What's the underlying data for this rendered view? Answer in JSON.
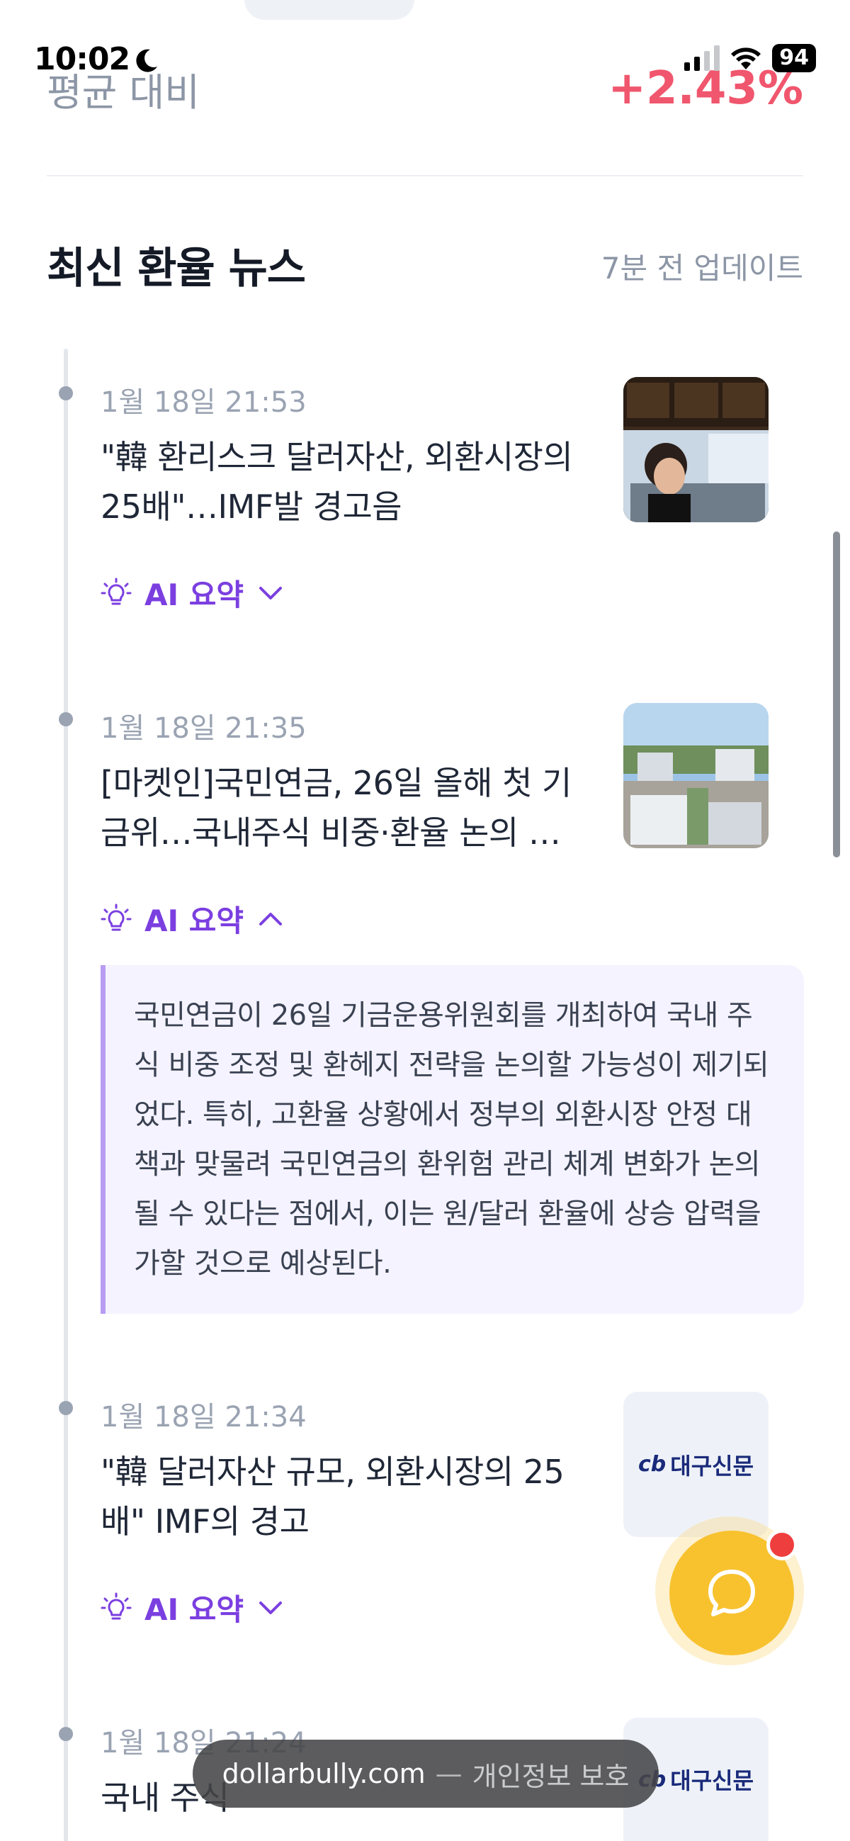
{
  "status_bar": {
    "time": "10:02",
    "battery": "94"
  },
  "summary": {
    "avg_label": "평균 대비",
    "avg_value": "+2.43%"
  },
  "news_section": {
    "title": "최신 환율 뉴스",
    "updated": "7분 전 업데이트",
    "ai_label": "AI 요약",
    "items": [
      {
        "date": "1월 18일 21:53",
        "title": "\"韓 환리스크 달러자산, 외환시장의 25배\"…IMF발 경고음",
        "thumb": "photo-trading-room",
        "expanded": false
      },
      {
        "date": "1월 18일 21:35",
        "title": "[마켓인]국민연금, 26일 올해 첫 기금위…국내주식 비중·환율 논의 …",
        "thumb": "photo-nps-building",
        "expanded": true,
        "summary": "국민연금이 26일 기금운용위원회를 개최하여 국내 주식 비중 조정 및 환헤지 전략을 논의할 가능성이 제기되었다. 특히, 고환율 상황에서 정부의 외환시장 안정 대책과 맞물려 국민연금의 환위험 관리 체계 변화가 논의될 수 있다는 점에서, 이는 원/달러 환율에 상승 압력을 가할 것으로 예상된다."
      },
      {
        "date": "1월 18일 21:34",
        "title": "\"韓 달러자산 규모, 외환시장의 25배\" IMF의 경고",
        "thumb": "logo-daegu-shinmun",
        "logo_mark": "cb",
        "logo_text": "대구신문",
        "expanded": false
      },
      {
        "date": "1월 18일 21:24",
        "title": "국내 주식",
        "thumb": "logo-daegu-shinmun",
        "logo_mark": "cb",
        "logo_text": "대구신문",
        "expanded": false
      }
    ]
  },
  "toast": {
    "domain": "dollarbully.com",
    "separator": "—",
    "privacy": "개인정보 보호"
  },
  "colors": {
    "accent_purple": "#7b3fe0",
    "positive_red": "#f0566d",
    "fab_yellow": "#f8c22f"
  }
}
